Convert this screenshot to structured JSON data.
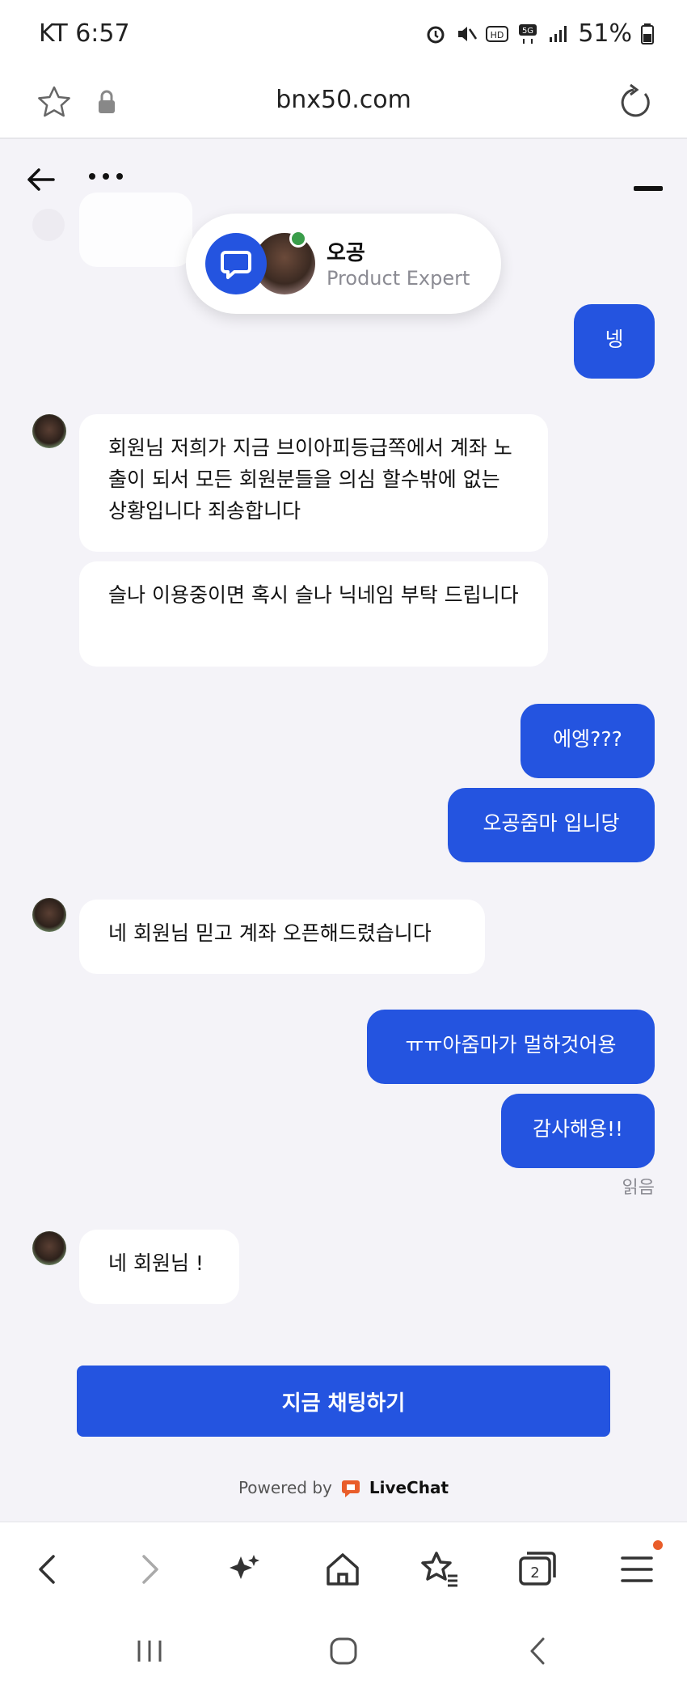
{
  "status_bar": {
    "carrier_time": "KT 6:57",
    "battery": "51%"
  },
  "url_bar": {
    "url": "bnx50.com"
  },
  "agent": {
    "name": "오공",
    "role": "Product Expert"
  },
  "messages": [
    {
      "from": "user",
      "text": "넹"
    },
    {
      "from": "agent",
      "text": "회원님 저희가 지금 브이아피등급쪽에서 계좌 노출이 되서 모든 회원분들을 의심 할수밖에 없는 상황입니다 죄송합니다"
    },
    {
      "from": "agent",
      "text": "슬나 이용중이면 혹시 슬나 닉네임 부탁 드립니다"
    },
    {
      "from": "user",
      "text": "에엥???"
    },
    {
      "from": "user",
      "text": "오공줌마 입니당"
    },
    {
      "from": "agent",
      "text": "네 회원님 믿고 계좌 오픈해드렸습니다"
    },
    {
      "from": "user",
      "text": "ㅠㅠ아줌마가 멀하것어용"
    },
    {
      "from": "user",
      "text": "감사해용!!"
    },
    {
      "from": "agent",
      "text": "네 회원님 !"
    }
  ],
  "read_receipt": "읽음",
  "cta_label": "지금 채팅하기",
  "powered_by": {
    "prefix": "Powered by",
    "brand": "LiveChat"
  },
  "toolbar": {
    "tabs_count": "2",
    "icons": [
      "back-icon",
      "forward-icon",
      "sparkle-icon",
      "home-icon",
      "bookmarks-icon",
      "tabs-icon",
      "menu-icon"
    ]
  },
  "colors": {
    "accent": "#2454e0",
    "background": "#f4f3f8",
    "online": "#3a9d4a",
    "brand_orange": "#e95d2a"
  }
}
